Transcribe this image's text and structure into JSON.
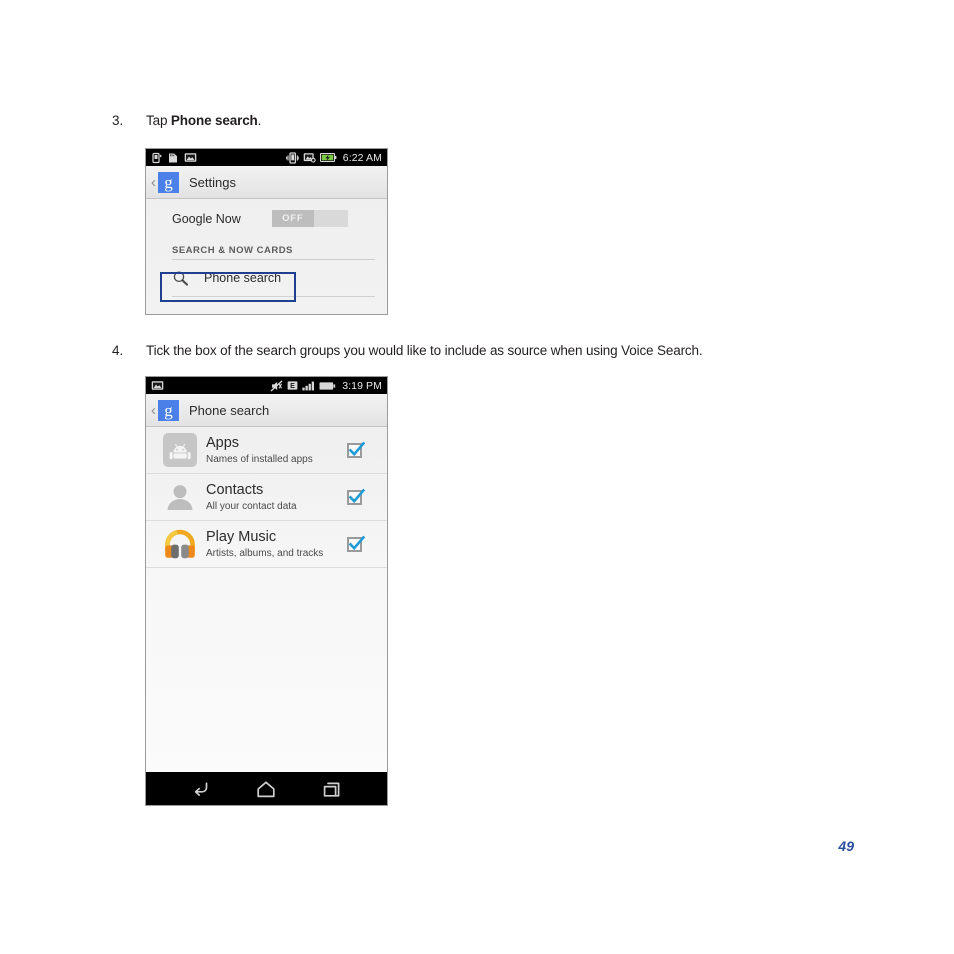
{
  "page": {
    "number": "49"
  },
  "steps": [
    {
      "num": "3.",
      "text_prefix": "Tap ",
      "text_bold": "Phone search",
      "text_suffix": "."
    },
    {
      "num": "4.",
      "text_full": "Tick the box of the search groups you would like to include as source when using Voice Search."
    }
  ],
  "screenshot1": {
    "statusbar": {
      "time": "6:22 AM",
      "left_icons": [
        "usb-debugging-icon",
        "sd-card-icon",
        "screenshot-icon"
      ],
      "right_icons": [
        "vibrate-icon",
        "sync-disabled-icon",
        "battery-charging-icon"
      ]
    },
    "actionbar": {
      "back_chevron": "‹",
      "app_badge": "g",
      "title": "Settings"
    },
    "google_now_row": {
      "label": "Google Now",
      "toggle_state": "OFF"
    },
    "section_header": "SEARCH & NOW CARDS",
    "phone_search_row": {
      "icon": "search-icon",
      "label": "Phone search",
      "highlighted": true
    }
  },
  "screenshot2": {
    "statusbar": {
      "time": "3:19 PM",
      "left_icons": [
        "screenshot-icon"
      ],
      "right_icons": [
        "silent-mode-icon",
        "edge-network-icon",
        "signal-bars-icon",
        "battery-icon"
      ]
    },
    "actionbar": {
      "back_chevron": "‹",
      "app_badge": "g",
      "title": "Phone search"
    },
    "list": [
      {
        "icon": "android-apps-icon",
        "title": "Apps",
        "subtitle": "Names of installed apps",
        "checked": true
      },
      {
        "icon": "contacts-person-icon",
        "title": "Contacts",
        "subtitle": "All your contact data",
        "checked": true
      },
      {
        "icon": "play-music-headphones-icon",
        "title": "Play Music",
        "subtitle": "Artists, albums, and tracks",
        "checked": true
      }
    ],
    "navbar": {
      "buttons": [
        "back-nav-icon",
        "home-nav-icon",
        "recent-apps-nav-icon"
      ]
    }
  },
  "colors": {
    "google_blue_badge": "#4a80e8",
    "checkbox_check": "#1f9bd6",
    "callout_border": "#1f3f91",
    "page_number": "#2b4f9e",
    "play_music_orange": "#f0a81e",
    "statusbar_bg": "#000000"
  }
}
